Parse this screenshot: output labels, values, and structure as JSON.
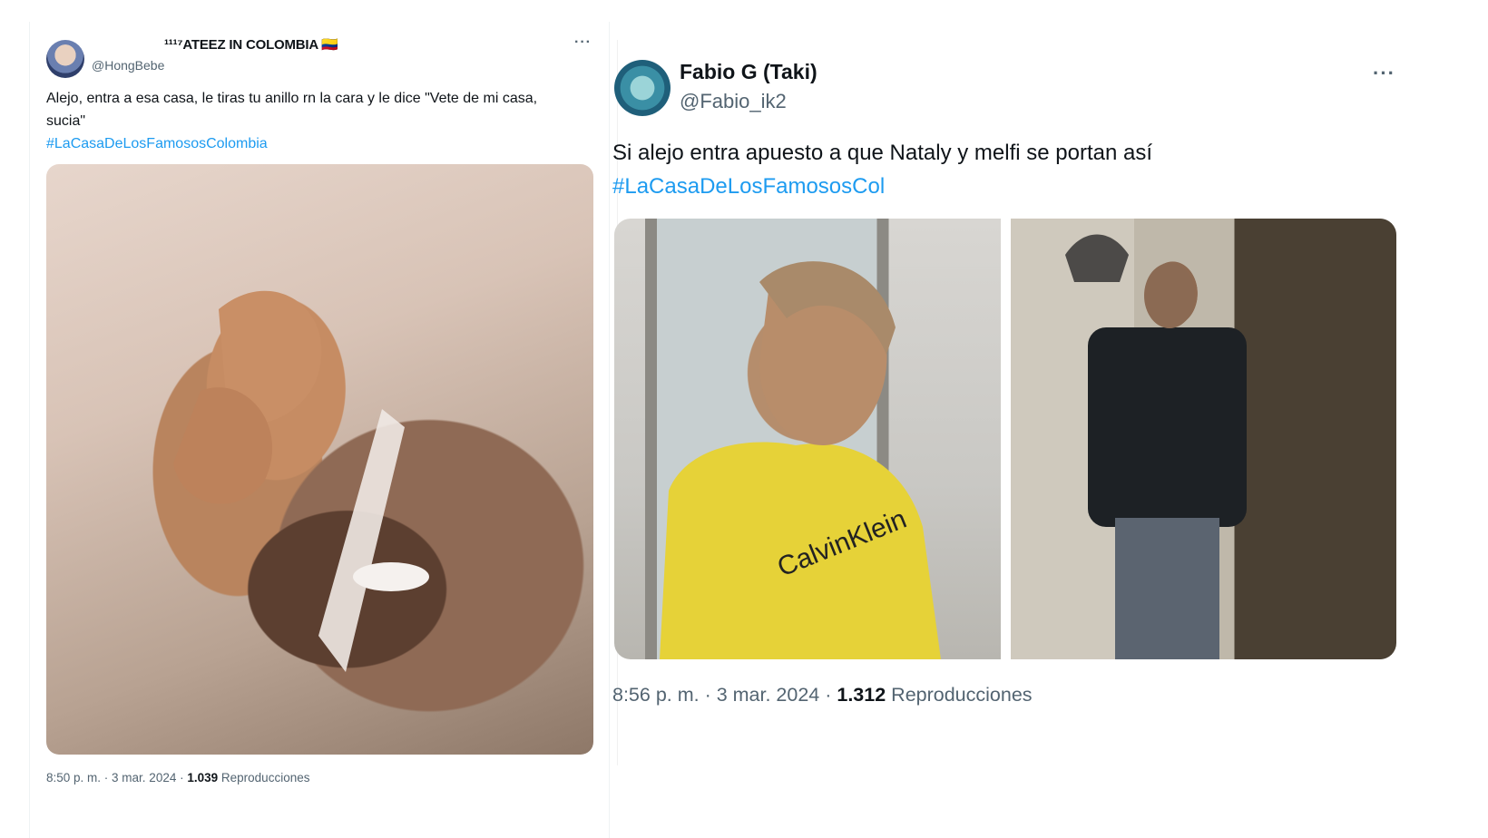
{
  "tweets": [
    {
      "display_name": "¹¹¹⁷ATEEZ IN COLOMBIA 🇨🇴",
      "handle": "@HongBebe",
      "more_label": "···",
      "text": "Alejo, entra a esa casa, le tiras tu anillo rn la cara y le dice \"Vete de mi casa, sucia\"",
      "hashtag": "#LaCasaDeLosFamososColombia",
      "time": "8:50 p. m.",
      "date": "3 mar. 2024",
      "views": "1.039",
      "views_label": "Reproducciones",
      "separator": " · "
    },
    {
      "display_name": "Fabio G (Taki)",
      "handle": "@Fabio_ik2",
      "more_label": "···",
      "text": "Si alejo entra apuesto a que Nataly y melfi se portan así",
      "hashtag": "#LaCasaDeLosFamososCol",
      "time": "8:56 p. m.",
      "date": "3 mar. 2024",
      "views": "1.312",
      "views_label": "Reproducciones",
      "separator": " · "
    }
  ],
  "media": {
    "tweet2_left_shirt_text": "CalvinKlein"
  },
  "colors": {
    "hashtag": "#1d9bf0",
    "secondary_text": "#536471",
    "primary_text": "#0f1419"
  }
}
